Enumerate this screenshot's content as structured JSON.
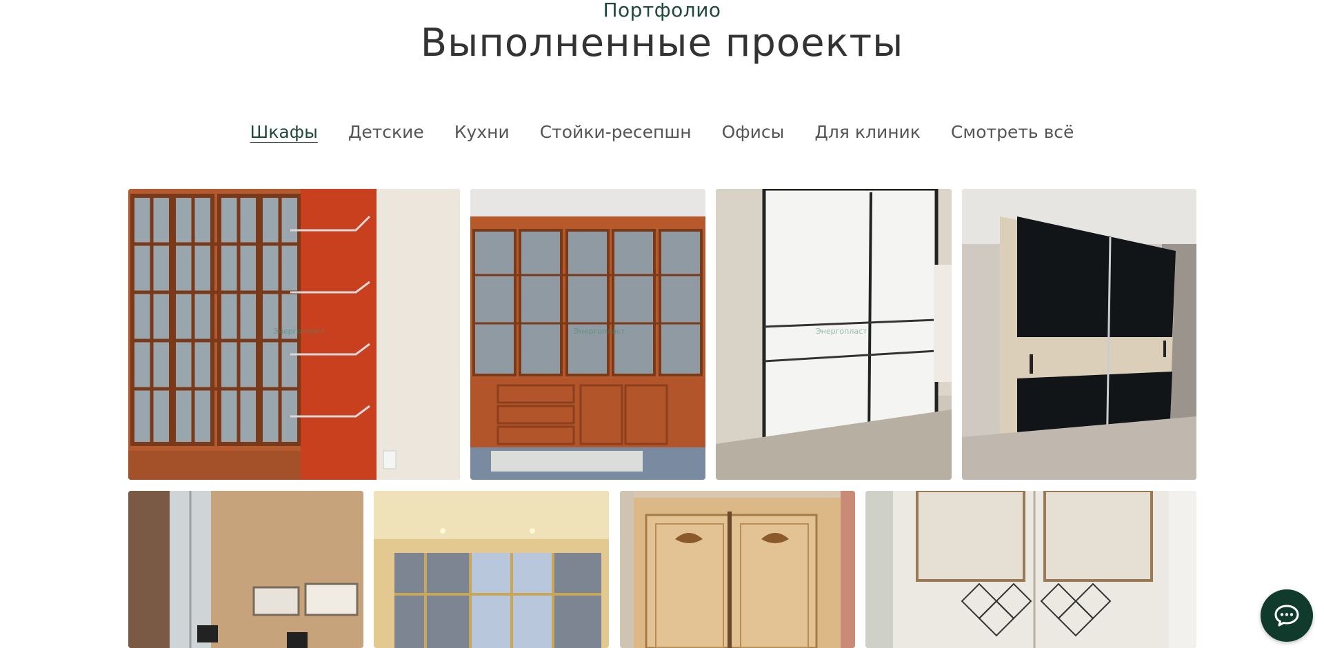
{
  "section": {
    "eyebrow": "Портфолио",
    "title": "Выполненные проекты"
  },
  "tabs": [
    {
      "label": "Шкафы",
      "active": true
    },
    {
      "label": "Детские",
      "active": false
    },
    {
      "label": "Кухни",
      "active": false
    },
    {
      "label": "Стойки-ресепшн",
      "active": false
    },
    {
      "label": "Офисы",
      "active": false
    },
    {
      "label": "Для клиник",
      "active": false
    },
    {
      "label": "Смотреть всё",
      "active": false
    }
  ],
  "gallery": {
    "watermark": "Энергопласт",
    "items": [
      {
        "name": "wardrobe-photo-1-red-glass-cabinet"
      },
      {
        "name": "wardrobe-photo-2-red-library"
      },
      {
        "name": "wardrobe-photo-3-white-sliding"
      },
      {
        "name": "wardrobe-photo-4-black-sliding"
      },
      {
        "name": "wardrobe-photo-5-mirror-wardrobe"
      },
      {
        "name": "wardrobe-photo-6-frosted-sliding"
      },
      {
        "name": "wardrobe-photo-7-carved-wood"
      },
      {
        "name": "wardrobe-photo-8-white-classic"
      }
    ]
  },
  "chat": {
    "icon": "chat-bubble-icon"
  }
}
